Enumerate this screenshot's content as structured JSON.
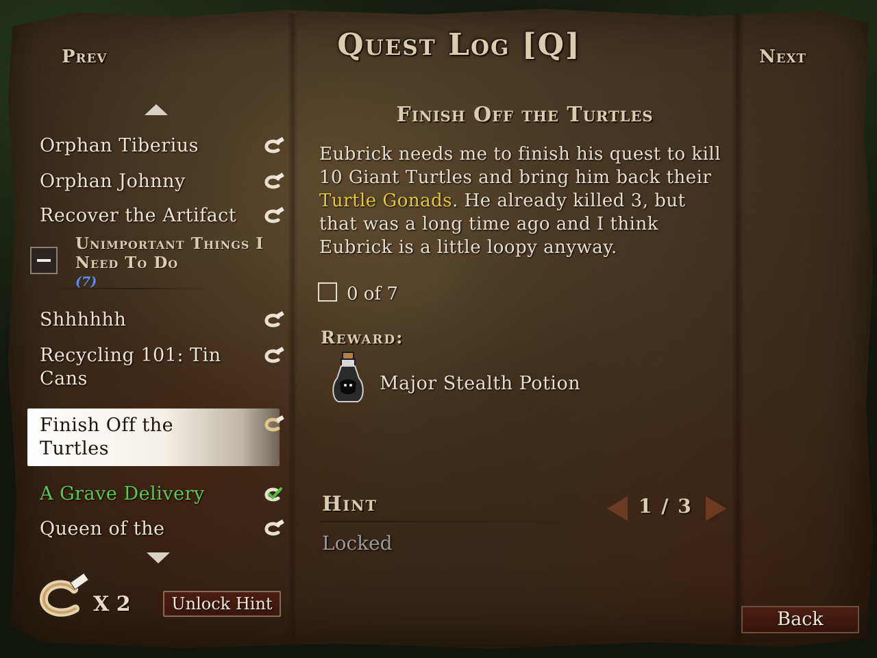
{
  "header": {
    "title": "Quest Log [Q]",
    "prev_label": "Prev",
    "next_label": "Next"
  },
  "quest_list": {
    "items_top": [
      {
        "label": "Orphan Tiberius",
        "icon": "hint-coin-icon"
      },
      {
        "label": "Orphan Johnny",
        "icon": "hint-coin-icon"
      },
      {
        "label": "Recover the Artifact",
        "icon": "hint-coin-icon"
      }
    ],
    "group": {
      "label": "Unimportant Things I Need To Do",
      "count": "(7)",
      "collapse_icon": "minus-icon"
    },
    "items_bottom": [
      {
        "label": "Shhhhhh",
        "icon": "hint-coin-icon"
      },
      {
        "label": "Recycling 101: Tin Cans",
        "icon": "hint-coin-icon"
      },
      {
        "label": "Finish Off the Turtles",
        "icon": "hint-coin-icon",
        "selected": true
      },
      {
        "label": "A Grave Delivery",
        "icon": "check-icon",
        "completed": true
      },
      {
        "label": "Queen of the",
        "icon": "hint-coin-icon"
      }
    ]
  },
  "detail": {
    "title": "Finish Off the Turtles",
    "desc_part1": "Eubrick needs me to finish his quest to kill 10 Giant Turtles and bring him back their ",
    "desc_highlight": "Turtle Gonads",
    "desc_part2": ". He already killed 3, but that was a long time ago and I think Eubrick is a little loopy anyway.",
    "objective": "0 of 7",
    "reward_label": "Reward:",
    "reward_item": "Major Stealth Potion",
    "reward_icon": "potion-icon"
  },
  "hint": {
    "label": "Hint",
    "page": "1 / 3",
    "status": "Locked"
  },
  "footer": {
    "hint_tokens": "X 2",
    "unlock_label": "Unlock Hint",
    "back_label": "Back"
  },
  "colors": {
    "highlight": "#e8c63a",
    "completed": "#5fc64f",
    "group_count": "#5a8cff"
  }
}
